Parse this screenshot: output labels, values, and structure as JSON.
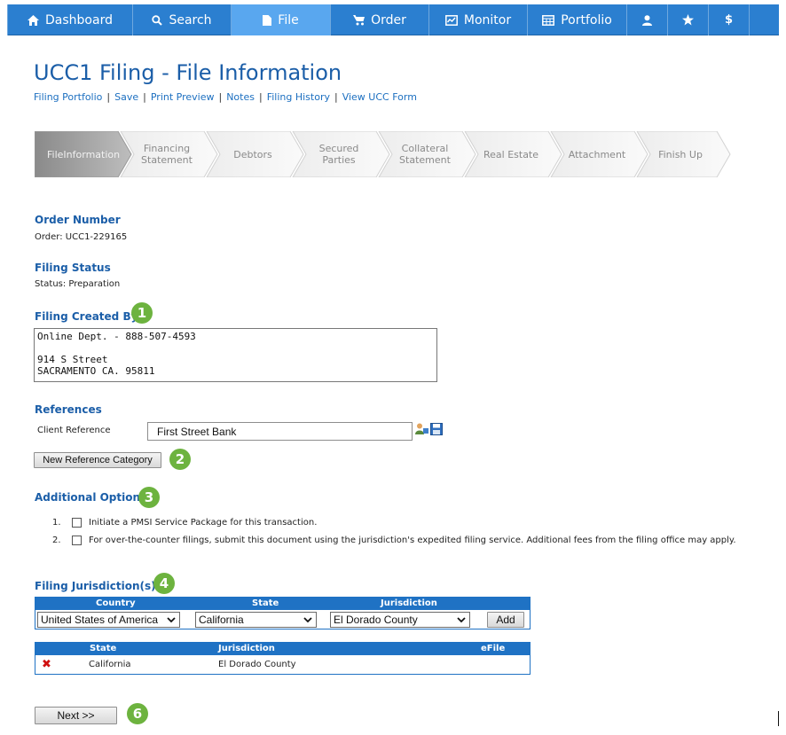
{
  "nav": {
    "items": [
      {
        "label": "Dashboard",
        "icon": "home-icon"
      },
      {
        "label": "Search",
        "icon": "search-icon"
      },
      {
        "label": "File",
        "icon": "file-icon"
      },
      {
        "label": "Order",
        "icon": "cart-icon"
      },
      {
        "label": "Monitor",
        "icon": "monitor-icon"
      },
      {
        "label": "Portfolio",
        "icon": "portfolio-icon"
      },
      {
        "label": "",
        "icon": "user-icon"
      },
      {
        "label": "",
        "icon": "star-icon"
      },
      {
        "label": "",
        "icon": "dollar-icon"
      }
    ],
    "active": "File",
    "dollar_glyph": "$"
  },
  "header": {
    "title": "UCC1 Filing - File Information",
    "links": [
      "Filing Portfolio",
      "Save",
      "Print Preview",
      "Notes",
      "Filing History",
      "View UCC Form"
    ]
  },
  "wizard": {
    "steps": [
      {
        "line1": "File",
        "line2": "Information",
        "active": true
      },
      {
        "line1": "Financing",
        "line2": "Statement",
        "active": false
      },
      {
        "line1": "Debtors",
        "line2": "",
        "active": false
      },
      {
        "line1": "Secured",
        "line2": "Parties",
        "active": false
      },
      {
        "line1": "Collateral",
        "line2": "Statement",
        "active": false
      },
      {
        "line1": "Real Estate",
        "line2": "",
        "active": false
      },
      {
        "line1": "Attachment",
        "line2": "",
        "active": false
      },
      {
        "line1": "Finish Up",
        "line2": "",
        "active": false
      }
    ]
  },
  "order": {
    "title": "Order Number",
    "text": "Order: UCC1-229165"
  },
  "status": {
    "title": "Filing Status",
    "text": "Status: Preparation"
  },
  "created_by": {
    "title": "Filing Created By",
    "badge": "1",
    "lines": [
      "Online Dept. - 888-507-4593",
      "",
      "914 S Street",
      "SACRAMENTO CA. 95811"
    ]
  },
  "references": {
    "title": "References",
    "client_label": "Client Reference",
    "client_value": "First Street Bank",
    "new_category_button": "New Reference Category",
    "badge": "2"
  },
  "additional_options": {
    "title": "Additional Options",
    "badge": "3",
    "items": [
      {
        "num": "1.",
        "text": "Initiate a PMSI Service Package for this transaction.",
        "checked": false
      },
      {
        "num": "2.",
        "text": "For over-the-counter filings, submit this document using the jurisdiction's expedited filing service. Additional fees from the filing office may apply.",
        "checked": false
      }
    ]
  },
  "jurisdiction": {
    "title": "Filing Jurisdiction(s)",
    "badge": "4",
    "input_headers": {
      "country": "Country",
      "state": "State",
      "jurisdiction": "Jurisdiction"
    },
    "country_value": "United States of America",
    "state_value": "California",
    "jurisdiction_value": "El Dorado County",
    "add_button": "Add",
    "list_headers": {
      "state": "State",
      "jurisdiction": "Jurisdiction",
      "efile": "eFile"
    },
    "rows": [
      {
        "state": "California",
        "jurisdiction": "El Dorado County",
        "efile": ""
      }
    ],
    "remove_glyph": "✖"
  },
  "footer": {
    "next_button": "Next >>",
    "badge": "6"
  },
  "colors": {
    "nav_bg": "#2b7fd0",
    "nav_active": "#59a7ef",
    "title": "#1b5ea8",
    "badge": "#6db33f",
    "table_head": "#1f72c4",
    "remove": "#d01010"
  }
}
